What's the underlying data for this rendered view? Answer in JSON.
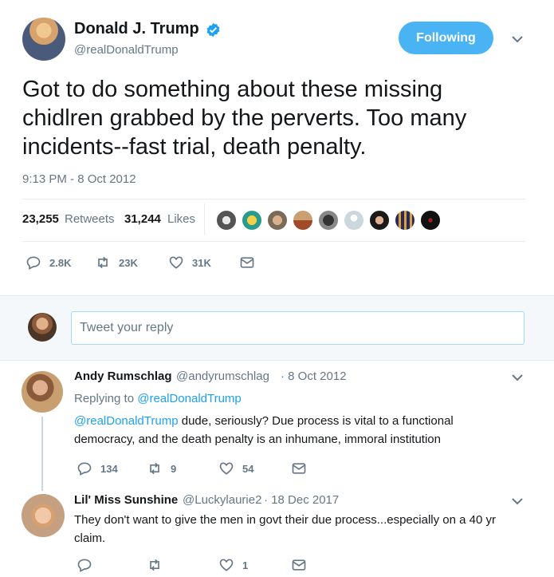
{
  "tweet": {
    "author_name": "Donald J. Trump",
    "author_handle": "@realDonaldTrump",
    "follow_label": "Following",
    "text_lines": [
      "Got to do something about these missing",
      "chidlren grabbed by the perverts. Too many",
      "incidents--fast trial, death penalty."
    ],
    "timestamp": "9:13 PM - 8 Oct 2012",
    "retweets_count": "23,255",
    "retweets_label": "Retweets",
    "likes_count": "31,244",
    "likes_label": "Likes",
    "actions": {
      "replies": "2.8K",
      "retweets": "23K",
      "likes": "31K"
    }
  },
  "reply_box": {
    "placeholder": "Tweet your reply"
  },
  "replies": [
    {
      "name": "Andy Rumschlag",
      "handle": "@andyrumschlag",
      "date": "· 8 Oct 2012",
      "replying_prefix": "Replying to",
      "replying_to": "@realDonaldTrump",
      "mention": "@realDonaldTrump",
      "text_line1": "dude, seriously?  Due process is vital to a functional",
      "text_line2": "democracy, and the death penalty is an inhumane, immoral institution",
      "replies": "134",
      "retweets": "9",
      "likes": "54"
    },
    {
      "name": "Lil' Miss Sunshine",
      "handle": "@Luckylaurie2",
      "date": "· 18 Dec 2017",
      "text_line1": "They don't want to give the men in govt their due process...especially on a 40 yr",
      "text_line2": "claim.",
      "likes": "1"
    }
  ],
  "colors": {
    "accent": "#1da1f2",
    "follow_bg": "#4ab3f4",
    "muted": "#657786",
    "border": "#e6ecf0"
  }
}
